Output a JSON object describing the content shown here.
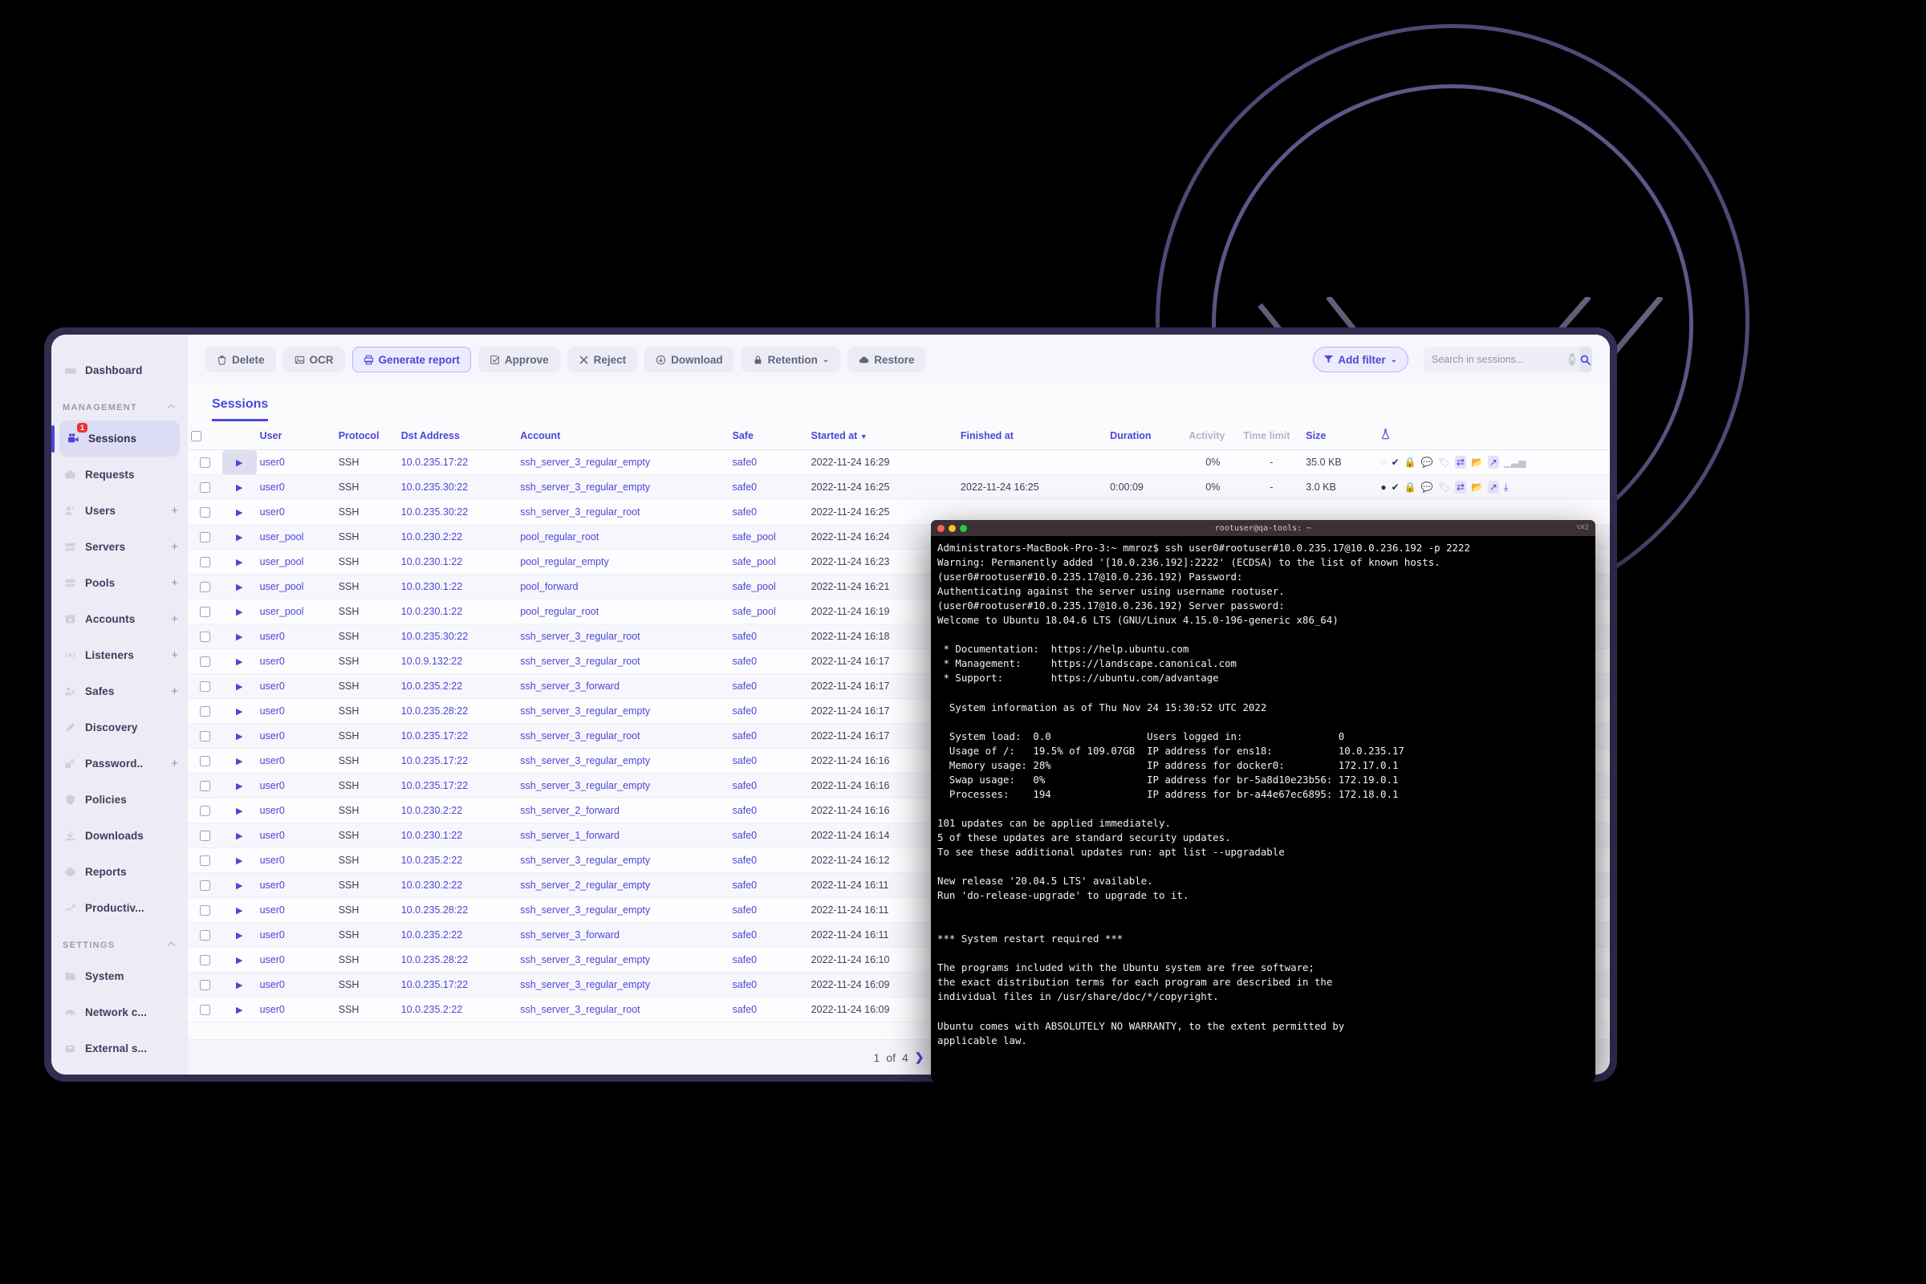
{
  "sidebar": {
    "top_item": {
      "label": "Dashboard",
      "icon": "dashboard-icon"
    },
    "sections": [
      {
        "title": "MANAGEMENT",
        "items": [
          {
            "label": "Sessions",
            "icon": "sessions-icon",
            "badge": "1",
            "active": true,
            "plus": ""
          },
          {
            "label": "Requests",
            "icon": "requests-icon",
            "badge": "",
            "active": false,
            "plus": ""
          },
          {
            "label": "Users",
            "icon": "users-icon",
            "badge": "",
            "active": false,
            "plus": "+"
          },
          {
            "label": "Servers",
            "icon": "servers-icon",
            "badge": "",
            "active": false,
            "plus": "+"
          },
          {
            "label": "Pools",
            "icon": "pools-icon",
            "badge": "",
            "active": false,
            "plus": "+"
          },
          {
            "label": "Accounts",
            "icon": "accounts-icon",
            "badge": "",
            "active": false,
            "plus": "+"
          },
          {
            "label": "Listeners",
            "icon": "listeners-icon",
            "badge": "",
            "active": false,
            "plus": "+"
          },
          {
            "label": "Safes",
            "icon": "safes-icon",
            "badge": "",
            "active": false,
            "plus": "+"
          },
          {
            "label": "Discovery",
            "icon": "discovery-icon",
            "badge": "",
            "active": false,
            "plus": ""
          },
          {
            "label": "Password..",
            "icon": "password-icon",
            "badge": "",
            "active": false,
            "plus": "+"
          },
          {
            "label": "Policies",
            "icon": "policies-icon",
            "badge": "",
            "active": false,
            "plus": ""
          },
          {
            "label": "Downloads",
            "icon": "downloads-icon",
            "badge": "",
            "active": false,
            "plus": ""
          },
          {
            "label": "Reports",
            "icon": "reports-icon",
            "badge": "",
            "active": false,
            "plus": ""
          },
          {
            "label": "Productiv...",
            "icon": "productivity-icon",
            "badge": "",
            "active": false,
            "plus": ""
          }
        ]
      },
      {
        "title": "SETTINGS",
        "items": [
          {
            "label": "System",
            "icon": "system-icon",
            "badge": "",
            "active": false,
            "plus": ""
          },
          {
            "label": "Network c...",
            "icon": "network-icon",
            "badge": "",
            "active": false,
            "plus": ""
          },
          {
            "label": "External s...",
            "icon": "external-icon",
            "badge": "",
            "active": false,
            "plus": ""
          }
        ]
      }
    ]
  },
  "toolbar": {
    "buttons": [
      {
        "label": "Delete",
        "icon": "trash-icon",
        "primary": false,
        "caret": false
      },
      {
        "label": "OCR",
        "icon": "image-icon",
        "primary": false,
        "caret": false
      },
      {
        "label": "Generate report",
        "icon": "printer-icon",
        "primary": true,
        "caret": false
      },
      {
        "label": "Approve",
        "icon": "check-box-icon",
        "primary": false,
        "caret": false
      },
      {
        "label": "Reject",
        "icon": "cross-icon",
        "primary": false,
        "caret": false
      },
      {
        "label": "Download",
        "icon": "download-icon",
        "primary": false,
        "caret": false
      },
      {
        "label": "Retention",
        "icon": "lock-icon",
        "primary": false,
        "caret": true
      },
      {
        "label": "Restore",
        "icon": "cloud-icon",
        "primary": false,
        "caret": false
      }
    ],
    "filter_label": "Add filter",
    "filter_icon": "funnel-icon",
    "search_placeholder": "Search in sessions...",
    "search_value": "",
    "search_icon": "search-icon",
    "clear_icon": "clear-icon"
  },
  "tabs": [
    {
      "label": "Sessions",
      "active": true
    }
  ],
  "table": {
    "columns": [
      {
        "key": "check",
        "label": "",
        "muted": false
      },
      {
        "key": "play",
        "label": "",
        "muted": false
      },
      {
        "key": "user",
        "label": "User",
        "muted": false
      },
      {
        "key": "protocol",
        "label": "Protocol",
        "muted": false
      },
      {
        "key": "dst",
        "label": "Dst Address",
        "muted": false
      },
      {
        "key": "account",
        "label": "Account",
        "muted": false
      },
      {
        "key": "safe",
        "label": "Safe",
        "muted": false
      },
      {
        "key": "started",
        "label": "Started at",
        "muted": false,
        "sort": "desc"
      },
      {
        "key": "finished",
        "label": "Finished at",
        "muted": false
      },
      {
        "key": "duration",
        "label": "Duration",
        "muted": false
      },
      {
        "key": "activity",
        "label": "Activity",
        "muted": true
      },
      {
        "key": "timelimit",
        "label": "Time limit",
        "muted": true
      },
      {
        "key": "size",
        "label": "Size",
        "muted": false
      },
      {
        "key": "flask",
        "label": "",
        "muted": false
      }
    ],
    "rows": [
      {
        "user": "user0",
        "protocol": "SSH",
        "dst": "10.0.235.17:22",
        "account": "ssh_server_3_regular_empty",
        "safe": "safe0",
        "started": "2022-11-24 16:29",
        "finished": "",
        "duration": "",
        "activity": "0%",
        "timelimit": "-",
        "size": "35.0 KB",
        "selected": true
      },
      {
        "user": "user0",
        "protocol": "SSH",
        "dst": "10.0.235.30:22",
        "account": "ssh_server_3_regular_empty",
        "safe": "safe0",
        "started": "2022-11-24 16:25",
        "finished": "2022-11-24 16:25",
        "duration": "0:00:09",
        "activity": "0%",
        "timelimit": "-",
        "size": "3.0 KB",
        "selected": false
      },
      {
        "user": "user0",
        "protocol": "SSH",
        "dst": "10.0.235.30:22",
        "account": "ssh_server_3_regular_root",
        "safe": "safe0",
        "started": "2022-11-24 16:25",
        "finished": "",
        "duration": "",
        "activity": "",
        "timelimit": "",
        "size": "",
        "selected": false
      },
      {
        "user": "user_pool",
        "protocol": "SSH",
        "dst": "10.0.230.2:22",
        "account": "pool_regular_root",
        "safe": "safe_pool",
        "started": "2022-11-24 16:24",
        "finished": "",
        "duration": "",
        "activity": "",
        "timelimit": "",
        "size": "",
        "selected": false
      },
      {
        "user": "user_pool",
        "protocol": "SSH",
        "dst": "10.0.230.1:22",
        "account": "pool_regular_empty",
        "safe": "safe_pool",
        "started": "2022-11-24 16:23",
        "finished": "",
        "duration": "",
        "activity": "",
        "timelimit": "",
        "size": "",
        "selected": false
      },
      {
        "user": "user_pool",
        "protocol": "SSH",
        "dst": "10.0.230.1:22",
        "account": "pool_forward",
        "safe": "safe_pool",
        "started": "2022-11-24 16:21",
        "finished": "",
        "duration": "",
        "activity": "",
        "timelimit": "",
        "size": "",
        "selected": false
      },
      {
        "user": "user_pool",
        "protocol": "SSH",
        "dst": "10.0.230.1:22",
        "account": "pool_regular_root",
        "safe": "safe_pool",
        "started": "2022-11-24 16:19",
        "finished": "",
        "duration": "",
        "activity": "",
        "timelimit": "",
        "size": "",
        "selected": false
      },
      {
        "user": "user0",
        "protocol": "SSH",
        "dst": "10.0.235.30:22",
        "account": "ssh_server_3_regular_root",
        "safe": "safe0",
        "started": "2022-11-24 16:18",
        "finished": "",
        "duration": "",
        "activity": "",
        "timelimit": "",
        "size": "",
        "selected": false
      },
      {
        "user": "user0",
        "protocol": "SSH",
        "dst": "10.0.9.132:22",
        "account": "ssh_server_3_regular_root",
        "safe": "safe0",
        "started": "2022-11-24 16:17",
        "finished": "",
        "duration": "",
        "activity": "",
        "timelimit": "",
        "size": "",
        "selected": false
      },
      {
        "user": "user0",
        "protocol": "SSH",
        "dst": "10.0.235.2:22",
        "account": "ssh_server_3_forward",
        "safe": "safe0",
        "started": "2022-11-24 16:17",
        "finished": "",
        "duration": "",
        "activity": "",
        "timelimit": "",
        "size": "",
        "selected": false
      },
      {
        "user": "user0",
        "protocol": "SSH",
        "dst": "10.0.235.28:22",
        "account": "ssh_server_3_regular_empty",
        "safe": "safe0",
        "started": "2022-11-24 16:17",
        "finished": "",
        "duration": "",
        "activity": "",
        "timelimit": "",
        "size": "",
        "selected": false
      },
      {
        "user": "user0",
        "protocol": "SSH",
        "dst": "10.0.235.17:22",
        "account": "ssh_server_3_regular_root",
        "safe": "safe0",
        "started": "2022-11-24 16:17",
        "finished": "",
        "duration": "",
        "activity": "",
        "timelimit": "",
        "size": "",
        "selected": false
      },
      {
        "user": "user0",
        "protocol": "SSH",
        "dst": "10.0.235.17:22",
        "account": "ssh_server_3_regular_empty",
        "safe": "safe0",
        "started": "2022-11-24 16:16",
        "finished": "",
        "duration": "",
        "activity": "",
        "timelimit": "",
        "size": "",
        "selected": false
      },
      {
        "user": "user0",
        "protocol": "SSH",
        "dst": "10.0.235.17:22",
        "account": "ssh_server_3_regular_empty",
        "safe": "safe0",
        "started": "2022-11-24 16:16",
        "finished": "",
        "duration": "",
        "activity": "",
        "timelimit": "",
        "size": "",
        "selected": false
      },
      {
        "user": "user0",
        "protocol": "SSH",
        "dst": "10.0.230.2:22",
        "account": "ssh_server_2_forward",
        "safe": "safe0",
        "started": "2022-11-24 16:16",
        "finished": "",
        "duration": "",
        "activity": "",
        "timelimit": "",
        "size": "",
        "selected": false
      },
      {
        "user": "user0",
        "protocol": "SSH",
        "dst": "10.0.230.1:22",
        "account": "ssh_server_1_forward",
        "safe": "safe0",
        "started": "2022-11-24 16:14",
        "finished": "",
        "duration": "",
        "activity": "",
        "timelimit": "",
        "size": "",
        "selected": false
      },
      {
        "user": "user0",
        "protocol": "SSH",
        "dst": "10.0.235.2:22",
        "account": "ssh_server_3_regular_empty",
        "safe": "safe0",
        "started": "2022-11-24 16:12",
        "finished": "",
        "duration": "",
        "activity": "",
        "timelimit": "",
        "size": "",
        "selected": false
      },
      {
        "user": "user0",
        "protocol": "SSH",
        "dst": "10.0.230.2:22",
        "account": "ssh_server_2_regular_empty",
        "safe": "safe0",
        "started": "2022-11-24 16:11",
        "finished": "",
        "duration": "",
        "activity": "",
        "timelimit": "",
        "size": "",
        "selected": false
      },
      {
        "user": "user0",
        "protocol": "SSH",
        "dst": "10.0.235.28:22",
        "account": "ssh_server_3_regular_empty",
        "safe": "safe0",
        "started": "2022-11-24 16:11",
        "finished": "",
        "duration": "",
        "activity": "",
        "timelimit": "",
        "size": "",
        "selected": false
      },
      {
        "user": "user0",
        "protocol": "SSH",
        "dst": "10.0.235.2:22",
        "account": "ssh_server_3_forward",
        "safe": "safe0",
        "started": "2022-11-24 16:11",
        "finished": "",
        "duration": "",
        "activity": "",
        "timelimit": "",
        "size": "",
        "selected": false
      },
      {
        "user": "user0",
        "protocol": "SSH",
        "dst": "10.0.235.28:22",
        "account": "ssh_server_3_regular_empty",
        "safe": "safe0",
        "started": "2022-11-24 16:10",
        "finished": "",
        "duration": "",
        "activity": "",
        "timelimit": "",
        "size": "",
        "selected": false
      },
      {
        "user": "user0",
        "protocol": "SSH",
        "dst": "10.0.235.17:22",
        "account": "ssh_server_3_regular_empty",
        "safe": "safe0",
        "started": "2022-11-24 16:09",
        "finished": "",
        "duration": "",
        "activity": "",
        "timelimit": "",
        "size": "",
        "selected": false
      },
      {
        "user": "user0",
        "protocol": "SSH",
        "dst": "10.0.235.2:22",
        "account": "ssh_server_3_regular_root",
        "safe": "safe0",
        "started": "2022-11-24 16:09",
        "finished": "",
        "duration": "",
        "activity": "",
        "timelimit": "",
        "size": "",
        "selected": false
      }
    ]
  },
  "pager": {
    "current": "1",
    "of_label": "of",
    "total": "4",
    "next_icon": "chevron-right-icon"
  },
  "terminal": {
    "title": "rootuser@qa-tools: ~",
    "right_glyphs": "⌥⌘2",
    "lines": "Administrators-MacBook-Pro-3:~ mmroz$ ssh user0#rootuser#10.0.235.17@10.0.236.192 -p 2222\nWarning: Permanently added '[10.0.236.192]:2222' (ECDSA) to the list of known hosts.\n(user0#rootuser#10.0.235.17@10.0.236.192) Password:\nAuthenticating against the server using username rootuser.\n(user0#rootuser#10.0.235.17@10.0.236.192) Server password:\nWelcome to Ubuntu 18.04.6 LTS (GNU/Linux 4.15.0-196-generic x86_64)\n\n * Documentation:  https://help.ubuntu.com\n * Management:     https://landscape.canonical.com\n * Support:        https://ubuntu.com/advantage\n\n  System information as of Thu Nov 24 15:30:52 UTC 2022\n\n  System load:  0.0                Users logged in:                0\n  Usage of /:   19.5% of 109.07GB  IP address for ens18:           10.0.235.17\n  Memory usage: 28%                IP address for docker0:         172.17.0.1\n  Swap usage:   0%                 IP address for br-5a8d10e23b56: 172.19.0.1\n  Processes:    194                IP address for br-a44e67ec6895: 172.18.0.1\n\n101 updates can be applied immediately.\n5 of these updates are standard security updates.\nTo see these additional updates run: apt list --upgradable\n\nNew release '20.04.5 LTS' available.\nRun 'do-release-upgrade' to upgrade to it.\n\n\n*** System restart required ***\n\nThe programs included with the Ubuntu system are free software;\nthe exact distribution terms for each program are described in the\nindividual files in /usr/share/doc/*/copyright.\n\nUbuntu comes with ABSOLUTELY NO WARRANTY, to the extent permitted by\napplicable law."
  },
  "colors": {
    "accent": "#4b47d6",
    "sidebar_bg": "#edecf6",
    "app_bg": "#fbfbfe",
    "badge_red": "#e8342d",
    "frame": "#2f2d50"
  }
}
